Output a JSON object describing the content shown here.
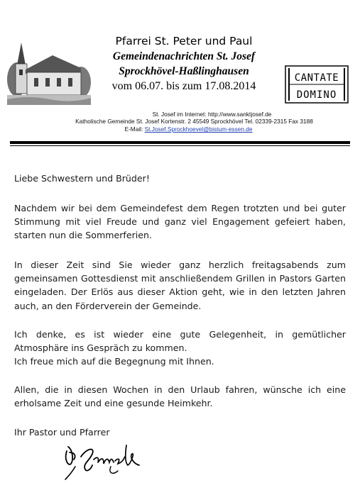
{
  "header": {
    "parish": "Pfarrei St. Peter und Paul",
    "newsletter_title": "Gemeindenachrichten St. Josef",
    "location": "Sprockhövel-Haßlinghausen",
    "date_range": "vom 06.07. bis zum 17.08.2014",
    "logo_text_line1": "CANTATE",
    "logo_text_line2": "DOMINO"
  },
  "contact": {
    "internet": "St. Josef im Internet: http://www.sanktjosef.de",
    "address": "Katholische Gemeinde St. Josef   Kortenstr. 2   45549 Sprockhövel   Tel. 02339-2315  Fax 3188",
    "email_label": "E-Mail:",
    "email": "St.Josef.Sprockhoevel@bistum-essen.de"
  },
  "letter": {
    "salutation": "Liebe Schwestern und Brüder!",
    "paragraph1": "Nachdem wir bei dem Gemeindefest dem Regen trotzten und bei guter Stimmung mit viel Freude und ganz viel Engagement gefeiert haben, starten nun die Sommerferien.",
    "paragraph2": "In dieser Zeit sind Sie wieder ganz herzlich freitagsabends zum gemeinsamen Gottesdienst mit anschließendem Grillen in Pastors Garten eingeladen. Der Erlös aus dieser Aktion geht, wie in den letzten Jahren auch, an den Förderverein der Gemeinde.",
    "paragraph3a": "Ich denke, es ist wieder eine gute Gelegenheit, in gemütlicher Atmosphäre ins Gespräch zu kommen.",
    "paragraph3b": "Ich freue mich auf die Begegnung mit Ihnen.",
    "paragraph4": "Allen, die in diesen Wochen in den Urlaub fahren, wünsche ich eine erholsame Zeit und eine gesunde Heimkehr.",
    "closing": "Ihr Pastor und Pfarrer",
    "signature_text": "G. Schmelz"
  },
  "colors": {
    "text": "#1a1a1a",
    "link": "#1f3fb0",
    "rule": "#000000"
  }
}
